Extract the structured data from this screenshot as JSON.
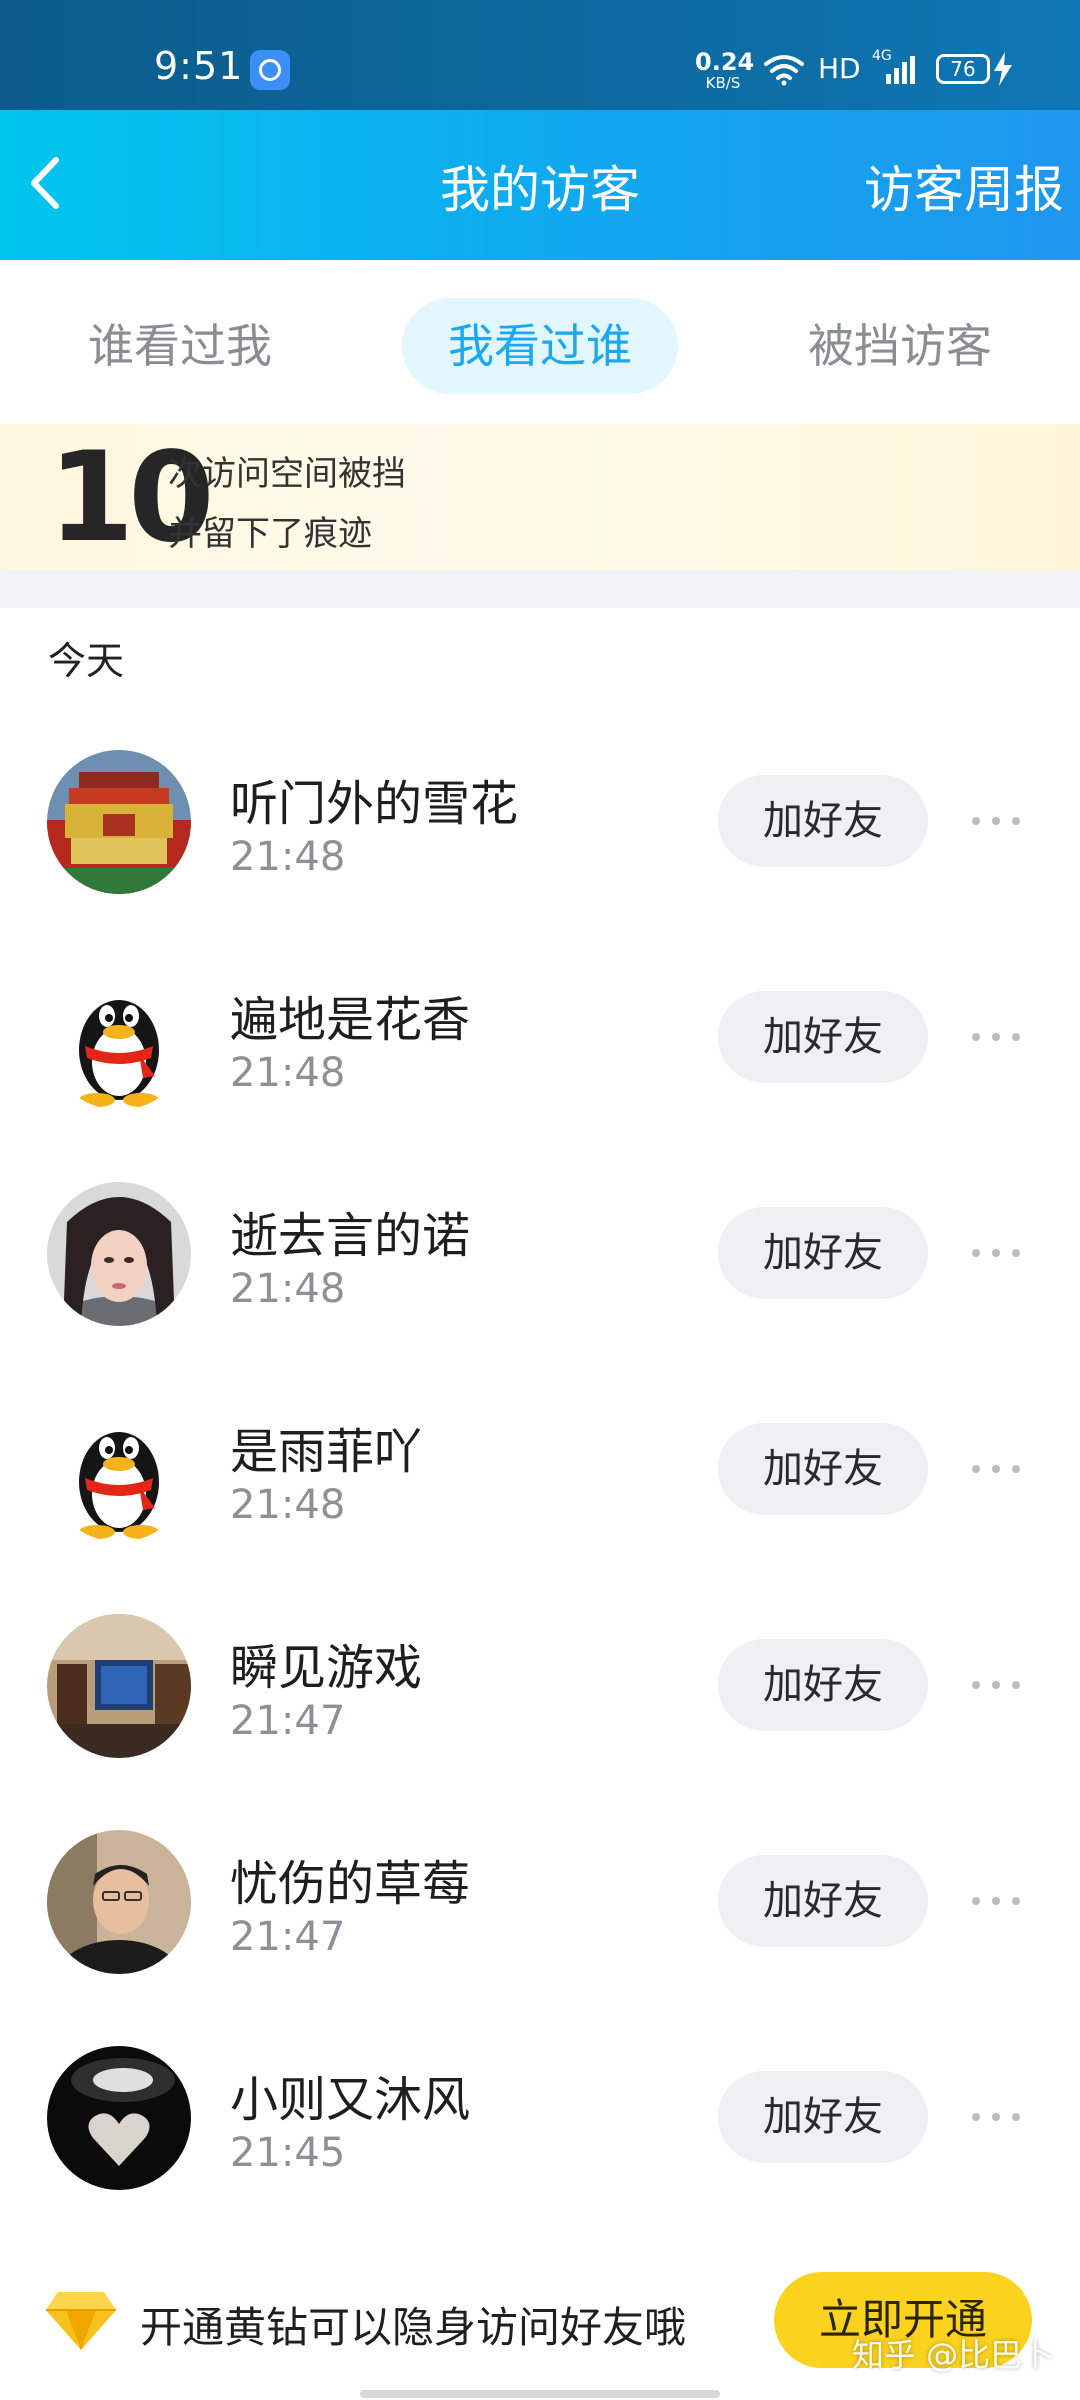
{
  "status_bar": {
    "time": "9:51",
    "net_speed_value": "0.24",
    "net_speed_unit": "KB/S",
    "hd": "HD",
    "network": "4G",
    "battery": "76",
    "icons": [
      "app-shortcut-icon",
      "wifi-icon",
      "signal-icon",
      "battery-icon",
      "charging-icon"
    ]
  },
  "nav": {
    "back_icon": "chevron-left-icon",
    "title": "我的访客",
    "right_action": "访客周报"
  },
  "tabs": [
    {
      "label": "谁看过我",
      "active": false
    },
    {
      "label": "我看过谁",
      "active": true
    },
    {
      "label": "被挡访客",
      "active": false
    }
  ],
  "banner": {
    "count": "10",
    "line1": "次访问空间被挡",
    "line2": "并留下了痕迹"
  },
  "section_title": "今天",
  "visitors": [
    {
      "name": "听门外的雪花",
      "time": "21:48",
      "action": "加好友",
      "avatar": "building-photo"
    },
    {
      "name": "遍地是花香",
      "time": "21:48",
      "action": "加好友",
      "avatar": "penguin-default"
    },
    {
      "name": "逝去言的诺",
      "time": "21:48",
      "action": "加好友",
      "avatar": "portrait-photo"
    },
    {
      "name": "是雨菲吖",
      "time": "21:48",
      "action": "加好友",
      "avatar": "penguin-default"
    },
    {
      "name": "瞬见游戏",
      "time": "21:47",
      "action": "加好友",
      "avatar": "room-photo"
    },
    {
      "name": "忧伤的草莓",
      "time": "21:47",
      "action": "加好友",
      "avatar": "man-photo"
    },
    {
      "name": "小则又沐风",
      "time": "21:45",
      "action": "加好友",
      "avatar": "heart-photo"
    }
  ],
  "promo": {
    "text": "开通黄钻可以隐身访问好友哦",
    "button": "立即开通",
    "icon": "yellow-diamond-icon"
  },
  "watermark": "知乎 @比巴卜",
  "colors": {
    "header_gradient_start": "#00c6ee",
    "header_gradient_end": "#1e97ee",
    "accent": "#1aa8f0",
    "promo_button": "#fbd31e"
  }
}
